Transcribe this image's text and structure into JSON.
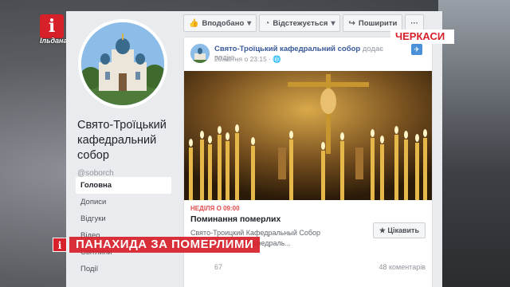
{
  "channel": {
    "logo_letter": "i",
    "logo_text": "Ільдана"
  },
  "city_label": "ЧЕРКАСИ",
  "lower_third": {
    "icon": "i",
    "text": "ПАНАХИДА ЗА ПОМЕРЛИМИ"
  },
  "page": {
    "name_line1": "Свято-Троїцький",
    "name_line2": "кафедральний",
    "name_line3": "собор",
    "handle": "@soborch",
    "nav": [
      "Головна",
      "Дописи",
      "Відгуки",
      "Відео",
      "Світлини",
      "Події"
    ]
  },
  "actions": [
    {
      "label": "Вподобано",
      "icon": "thumbs-up-icon"
    },
    {
      "label": "Відстежується",
      "icon": "rss-icon"
    },
    {
      "label": "Поширити",
      "icon": "share-icon"
    },
    {
      "label": "···",
      "icon": "more-icon"
    }
  ],
  "post": {
    "author": "Свято-Троїцький кафедральний собор",
    "action": "додає подію.",
    "time": "20 квітня о 23:15 · 🌐",
    "event_date": "НЕДІЛЯ О 09:00",
    "event_title": "Поминання померлих",
    "location": "Свято-Троицкий Кафедральный Собор",
    "location_sub": "Свято-Троїцький кафедраль...",
    "interest_label": "★ Цікавить",
    "reactions_count": "67",
    "comments": "48 коментарів"
  },
  "colors": {
    "accent_red": "#d6202a",
    "fb_blue": "#385898"
  }
}
